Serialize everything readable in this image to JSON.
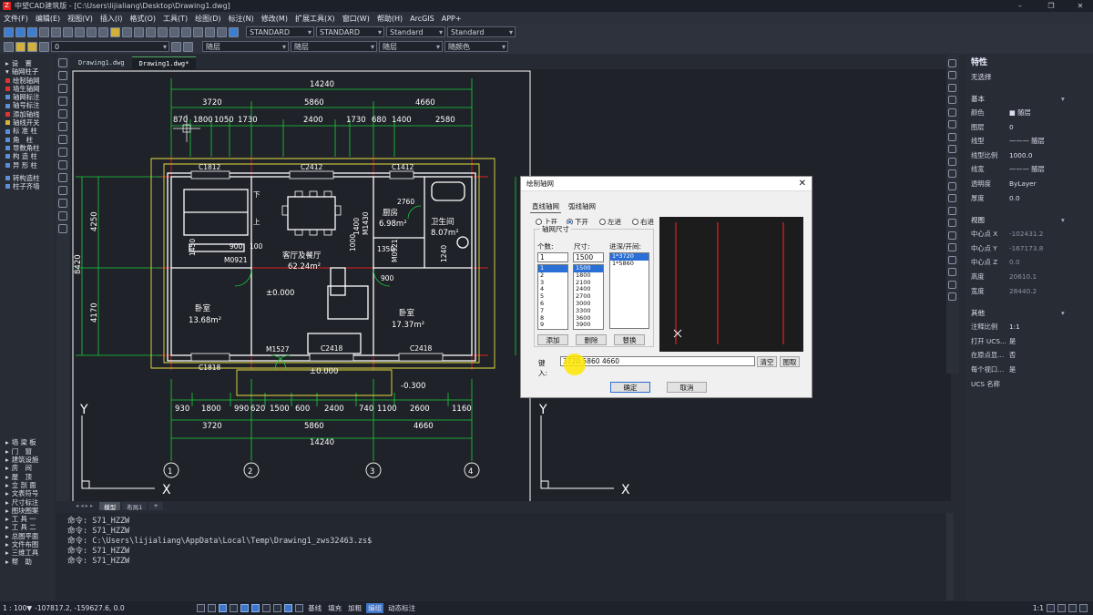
{
  "titlebar": {
    "title": "中望CAD建筑版 - [C:\\Users\\lijialiang\\Desktop\\Drawing1.dwg]",
    "min": "–",
    "max": "❐",
    "close": "✕"
  },
  "menu": [
    "文件(F)",
    "编辑(E)",
    "视图(V)",
    "插入(I)",
    "格式(O)",
    "工具(T)",
    "绘图(D)",
    "标注(N)",
    "修改(M)",
    "扩展工具(X)",
    "窗口(W)",
    "帮助(H)",
    "ArcGIS",
    "APP+"
  ],
  "toolbar": {
    "textstyle": "STANDARD",
    "dimstyle": "STANDARD",
    "tablestyle": "Standard",
    "mlstyle": "Standard",
    "layer": "0",
    "color": "随层",
    "linetype": "随层",
    "lineweight": "随层",
    "plotstyle": "随颜色"
  },
  "left_top": [
    {
      "label": "设　置",
      "icon": "▸"
    },
    {
      "label": "轴网柱子",
      "icon": "▾"
    },
    {
      "label": "绘制轴网"
    },
    {
      "label": "墙生轴网"
    },
    {
      "label": "轴网标注"
    },
    {
      "label": "轴号标注"
    },
    {
      "label": "添加轴线"
    },
    {
      "label": "轴线开关"
    },
    {
      "label": "标 准 柱"
    },
    {
      "label": "角　柱"
    },
    {
      "label": "导数角柱"
    },
    {
      "label": "构 造 柱"
    },
    {
      "label": "异 形 柱"
    },
    {
      "label": "转构造柱"
    },
    {
      "label": "柱子齐墙"
    }
  ],
  "left_bottom": [
    "墙 梁 板",
    "门　窗",
    "建筑设施",
    "房　间",
    "屋　顶",
    "立 剖 面",
    "文表符号",
    "尺寸标注",
    "图块图案",
    "工 具 一",
    "工 具 二",
    "总图平面",
    "文件布图",
    "三维工具",
    "帮　助"
  ],
  "tabs": [
    "Drawing1.dwg",
    "Drawing1.dwg*"
  ],
  "model_tabs": [
    "模型",
    "布局1",
    "+"
  ],
  "plan": {
    "dims_top1": "14240",
    "dims_top2": [
      "3720",
      "5860",
      "4660"
    ],
    "dims_top3": [
      "870",
      "1800",
      "1050",
      "1730",
      "2400",
      "1730",
      "680",
      "1400",
      "2580"
    ],
    "dims_bot3": [
      "930",
      "1800",
      "990",
      "620",
      "1500",
      "600",
      "2400",
      "740",
      "1100",
      "2600",
      "1160"
    ],
    "dims_bot2": [
      "3720",
      "5860",
      "4660"
    ],
    "dims_bot1": "14240",
    "left_dims": [
      "4250",
      "8420",
      "4170"
    ],
    "windows": [
      "C1812",
      "C2412",
      "C1412",
      "C1818",
      "C2418",
      "C2418"
    ],
    "doors": [
      "M0921",
      "M0921",
      "M1527",
      "M1430"
    ],
    "rooms": [
      {
        "name": "客厅及餐厅",
        "area": "62.24m²"
      },
      {
        "name": "卧室",
        "area": "13.68m²"
      },
      {
        "name": "卧室",
        "area": "17.37m²"
      },
      {
        "name": "厨房",
        "area": "6.98m²"
      },
      {
        "name": "卫生间",
        "area": "8.07m²"
      }
    ],
    "elev": [
      "±0.000",
      "±0.000",
      "-0.300"
    ],
    "stair": [
      "下",
      "上"
    ],
    "misc": [
      "2760",
      "1450",
      "900",
      "100",
      "1350",
      "1240",
      "900",
      "1400",
      "1000"
    ],
    "axes": [
      "1",
      "2",
      "3",
      "4"
    ],
    "ucs_y": "Y",
    "ucs_x": "X"
  },
  "dialog": {
    "title": "绘制轴网",
    "tabs": [
      "直线轴网",
      "弧线轴网"
    ],
    "radios": [
      "上开",
      "下开",
      "左进",
      "右进"
    ],
    "group": "轴网尺寸",
    "count_label": "个数:",
    "size_label": "尺寸:",
    "list_label": "进深/开间:",
    "count_value": "1",
    "size_value": "1500",
    "counts": [
      "1",
      "2",
      "3",
      "4",
      "5",
      "6",
      "7",
      "8",
      "9"
    ],
    "sizes": [
      "1500",
      "1800",
      "2100",
      "2400",
      "2700",
      "3000",
      "3300",
      "3600",
      "3900"
    ],
    "items": [
      "1*3720",
      "1*5860"
    ],
    "add": "添加",
    "delete": "删除",
    "replace": "替换",
    "input_label": "键入:",
    "input_value": "3720 5860 4660",
    "clear": "清空",
    "pick": "图取",
    "ok": "确定",
    "cancel": "取消"
  },
  "props": {
    "title": "特性",
    "selection": "无选择",
    "basic": "基本",
    "rows": [
      [
        "颜色",
        "■ 随层"
      ],
      [
        "图层",
        "0"
      ],
      [
        "线型",
        "——— 随层"
      ],
      [
        "线型比例",
        "1000.0"
      ],
      [
        "线宽",
        "——— 随层"
      ],
      [
        "透明度",
        "ByLayer"
      ],
      [
        "厚度",
        "0.0"
      ]
    ],
    "view": "视图",
    "view_rows": [
      [
        "中心点 X",
        "-102431.2"
      ],
      [
        "中心点 Y",
        "-167173.8"
      ],
      [
        "中心点 Z",
        "0.0"
      ],
      [
        "高度",
        "20610.1"
      ],
      [
        "宽度",
        "28440.2"
      ]
    ],
    "other": "其他",
    "other_rows": [
      [
        "注释比例",
        "1:1"
      ],
      [
        "打开 UCS...",
        "是"
      ],
      [
        "在原点显...",
        "否"
      ],
      [
        "每个视口...",
        "是"
      ],
      [
        "UCS 名称",
        ""
      ]
    ]
  },
  "cmd": [
    "命令: S71_HZZW",
    "命令: S71_HZZW",
    "命令: C:\\Users\\lijialiang\\AppData\\Local\\Temp\\Drawing1_zws32463.zs$",
    "命令: S71_HZZW",
    "命令: S71_HZZW"
  ],
  "status": {
    "scale": "1 : 100▼",
    "coords": "-107817.2, -159627.6, 0.0",
    "labels": [
      "基线",
      "填充",
      "加粗",
      "编组",
      "动态标注"
    ],
    "right": "1:1"
  },
  "colors": {
    "red": "#e02020",
    "green": "#19d23b",
    "yellow": "#e8e040",
    "white": "#ffffff",
    "canvas": "#1f2228"
  }
}
